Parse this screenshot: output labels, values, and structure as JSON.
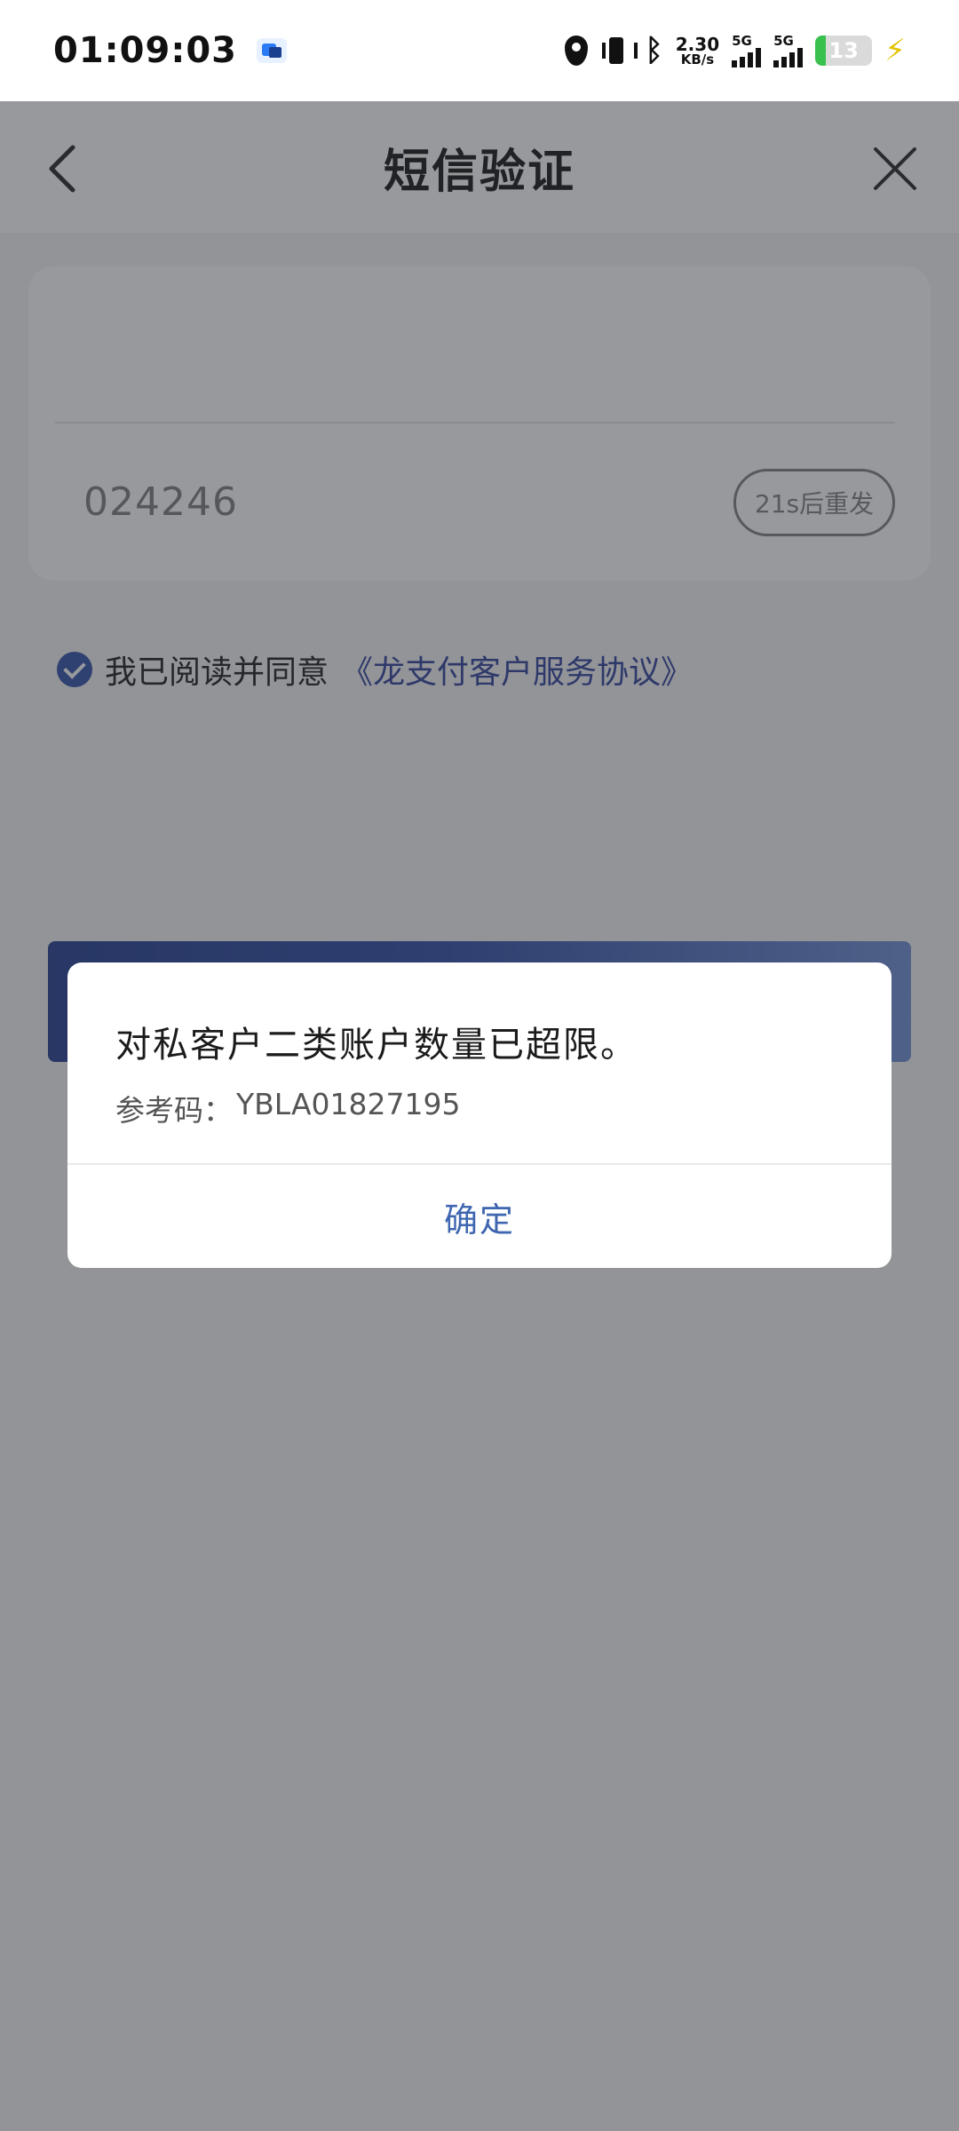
{
  "status_bar": {
    "time": "01:09:03",
    "net_speed_value": "2.30",
    "net_speed_unit": "KB/s",
    "sim1_label": "5G",
    "sim2_label": "5G",
    "battery_level": "13"
  },
  "header": {
    "title": "短信验证"
  },
  "verification": {
    "code_value": "024246",
    "resend_label": "21s后重发"
  },
  "agreement": {
    "text": "我已阅读并同意",
    "link": "《龙支付客户服务协议》"
  },
  "dialog": {
    "message": "对私客户二类账户数量已超限。",
    "ref_label": "参考码：",
    "ref_code": "YBLA01827195",
    "confirm_label": "确定"
  },
  "colors": {
    "accent": "#2a3f9a",
    "dialog_button": "#3f66b0",
    "overlay": "#32343a"
  }
}
